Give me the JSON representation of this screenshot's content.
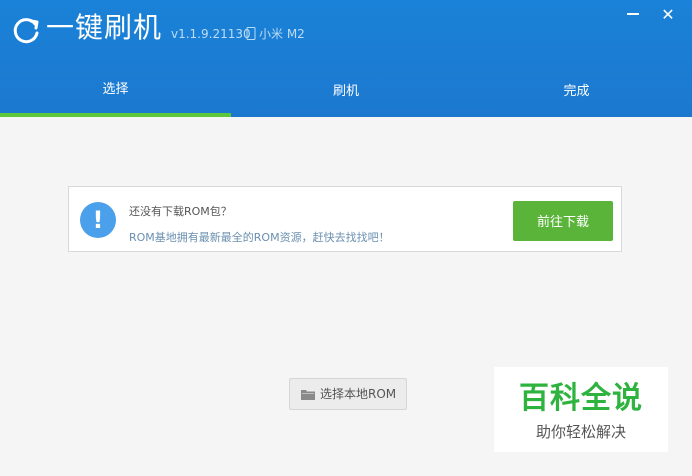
{
  "app": {
    "title": "一键刷机",
    "version": "v1.1.9.21130",
    "device": "小米 M2",
    "logo_icon": "refresh-circle-icon",
    "device_icon": "phone-icon",
    "minimize_icon": "minimize-icon",
    "close_icon": "close-icon",
    "close_symbol": "✕"
  },
  "tabs": [
    {
      "label": "选择",
      "active": true
    },
    {
      "label": "刷机",
      "active": false
    },
    {
      "label": "完成",
      "active": false
    }
  ],
  "notice": {
    "icon": "exclamation-circle-icon",
    "icon_symbol": "!",
    "title": "还没有下载ROM包？",
    "description": "ROM基地拥有最新最全的ROM资源，赶快去找找吧！",
    "button_label": "前往下载"
  },
  "local_rom": {
    "icon": "folder-icon",
    "label": "选择本地ROM"
  },
  "watermark": {
    "title": "百科全说",
    "subtitle": "助你轻松解决"
  },
  "colors": {
    "header": "#1a7fd6",
    "tab_indicator": "#5ec63a",
    "download_button": "#5bb43a",
    "alert_icon": "#4aa0ea",
    "watermark_green": "#2fb33f"
  }
}
